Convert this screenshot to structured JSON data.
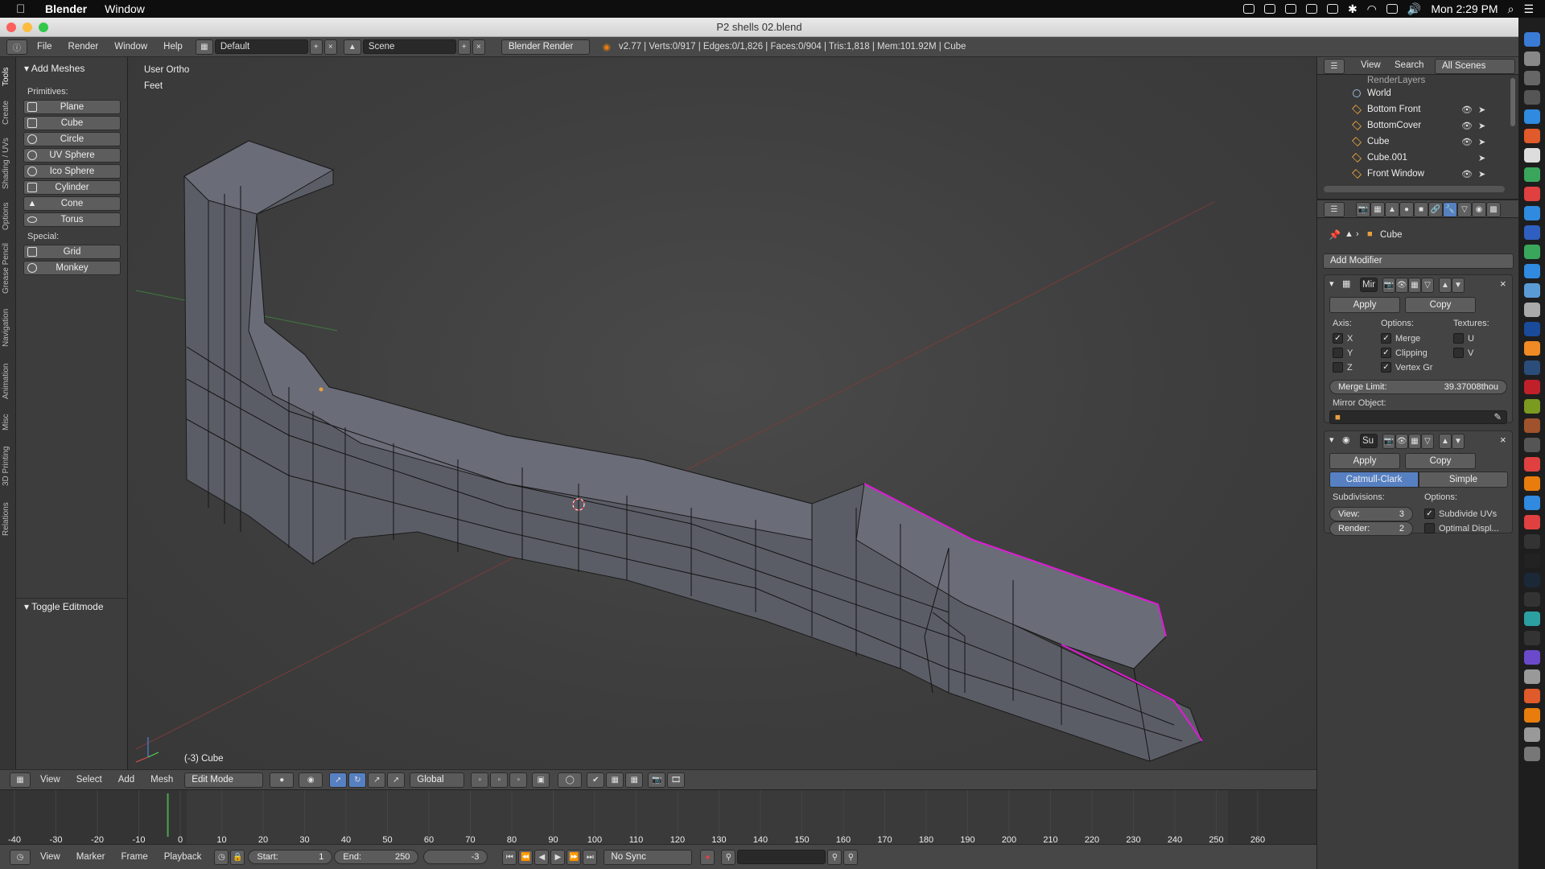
{
  "menubar": {
    "app_name": "Blender",
    "menu_window": "Window",
    "clock": "Mon 2:29 PM"
  },
  "window": {
    "title": "P2 shells 02.blend"
  },
  "info_header": {
    "menus": [
      "File",
      "Render",
      "Window",
      "Help"
    ],
    "layout": "Default",
    "scene": "Scene",
    "engine": "Blender Render",
    "stats": "v2.77 | Verts:0/917 | Edges:0/1,826 | Faces:0/904 | Tris:1,818 | Mem:101.92M | Cube"
  },
  "tool_tabs": [
    "Tools",
    "Create",
    "Shading / UVs",
    "Options",
    "Grease Pencil",
    "Navigation",
    "Animation",
    "Misc",
    "3D Printing",
    "Relations"
  ],
  "tool_shelf": {
    "panel_title": "Add Meshes",
    "primitives_label": "Primitives:",
    "primitives": [
      "Plane",
      "Cube",
      "Circle",
      "UV Sphere",
      "Ico Sphere",
      "Cylinder",
      "Cone",
      "Torus"
    ],
    "special_label": "Special:",
    "special": [
      "Grid",
      "Monkey"
    ],
    "operator_panel": "Toggle Editmode"
  },
  "viewport": {
    "view_name": "User Ortho",
    "units": "Feet",
    "object_info": "(-3) Cube"
  },
  "view3d_header": {
    "menus": [
      "View",
      "Select",
      "Add",
      "Mesh"
    ],
    "mode": "Edit Mode",
    "orientation": "Global"
  },
  "timeline": {
    "ticks": [
      "-40",
      "-30",
      "-20",
      "-10",
      "0",
      "10",
      "20",
      "30",
      "40",
      "50",
      "60",
      "70",
      "80",
      "90",
      "100",
      "110",
      "120",
      "130",
      "140",
      "150",
      "160",
      "170",
      "180",
      "190",
      "200",
      "210",
      "220",
      "230",
      "240",
      "250",
      "260"
    ],
    "current_frame_value": -3,
    "menus": [
      "View",
      "Marker",
      "Frame",
      "Playback"
    ],
    "start_label": "Start:",
    "start": "1",
    "end_label": "End:",
    "end": "250",
    "current": "-3",
    "sync": "No Sync"
  },
  "outliner": {
    "menus": [
      "View",
      "Search"
    ],
    "filter": "All Scenes",
    "items": [
      "RenderLayers",
      "World",
      "Bottom Front",
      "BottomCover",
      "Cube",
      "Cube.001",
      "Front Window"
    ]
  },
  "properties": {
    "context_object": "Cube",
    "add_modifier": "Add Modifier",
    "mirror": {
      "name": "Mir",
      "apply": "Apply",
      "copy": "Copy",
      "axis_label": "Axis:",
      "options_label": "Options:",
      "textures_label": "Textures:",
      "axes": [
        {
          "label": "X",
          "checked": true
        },
        {
          "label": "Y",
          "checked": false
        },
        {
          "label": "Z",
          "checked": false
        }
      ],
      "options": [
        {
          "label": "Merge",
          "checked": true
        },
        {
          "label": "Clipping",
          "checked": true
        },
        {
          "label": "Vertex Gr",
          "checked": true
        }
      ],
      "textures": [
        {
          "label": "U",
          "checked": false
        },
        {
          "label": "V",
          "checked": false
        }
      ],
      "merge_limit_label": "Merge Limit:",
      "merge_limit": "39.37008thou",
      "mirror_object_label": "Mirror Object:"
    },
    "subsurf": {
      "name": "Su",
      "apply": "Apply",
      "copy": "Copy",
      "tab_catmull": "Catmull-Clark",
      "tab_simple": "Simple",
      "subdivisions_label": "Subdivisions:",
      "options_label": "Options:",
      "view_label": "View:",
      "view": "3",
      "render_label": "Render:",
      "render": "2",
      "subdivide_uvs": "Subdivide UVs",
      "subdivide_uvs_checked": true,
      "optimal_display": "Optimal Displ...",
      "optimal_display_checked": false
    }
  },
  "colors": {
    "accent_blue": "#5680c2",
    "seam_magenta": "#e01ad6",
    "axis_red": "#a43c3c",
    "axis_green": "#4fa14f"
  }
}
